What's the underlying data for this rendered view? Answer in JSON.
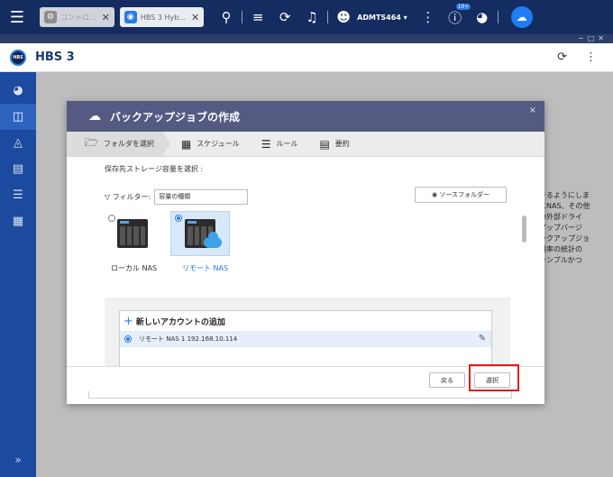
{
  "topbar": {
    "tabs": [
      {
        "label": "コントロ...",
        "icon": "gear-icon",
        "color": "#8e8e8e"
      },
      {
        "label": "HBS 3 Hyb...",
        "icon": "hbs-icon",
        "color": "#2a7be4"
      }
    ],
    "user": "ADMTS464",
    "notification_badge": "10+"
  },
  "app": {
    "title": "HBS 3"
  },
  "background_text": "きるようにしま\nにNAS、その他\nの外部ドライ\nアップバージ\nックアップジョ\n用率の統計の\nシンプルかつ",
  "dialog": {
    "title": "バックアップジョブの作成",
    "close": "×",
    "steps": [
      {
        "label": "フォルダを選択",
        "icon": "folder-icon"
      },
      {
        "label": "スケジュール",
        "icon": "calendar-icon"
      },
      {
        "label": "ルール",
        "icon": "sliders-icon"
      },
      {
        "label": "要約",
        "icon": "summary-icon"
      }
    ],
    "section_label": "保存先ストレージ容量を選択 :",
    "filter_label": "フィルター:",
    "filter_value": "容量の種類",
    "source_folder_button": "ソースフォルダー",
    "local_nas_label": "ローカル NAS",
    "remote_nas_label": "リモート NAS",
    "add_account_label": "新しいアカウントの追加",
    "account_row": "リモート NAS 1  192.168.10.114",
    "back_button": "戻る",
    "select_button": "選択"
  },
  "colors": {
    "topbar": "#142c60",
    "nav": "#1b4a9e",
    "dialog_title": "#545a82",
    "accent": "#2a7be4",
    "highlight": "#e21b1b"
  }
}
